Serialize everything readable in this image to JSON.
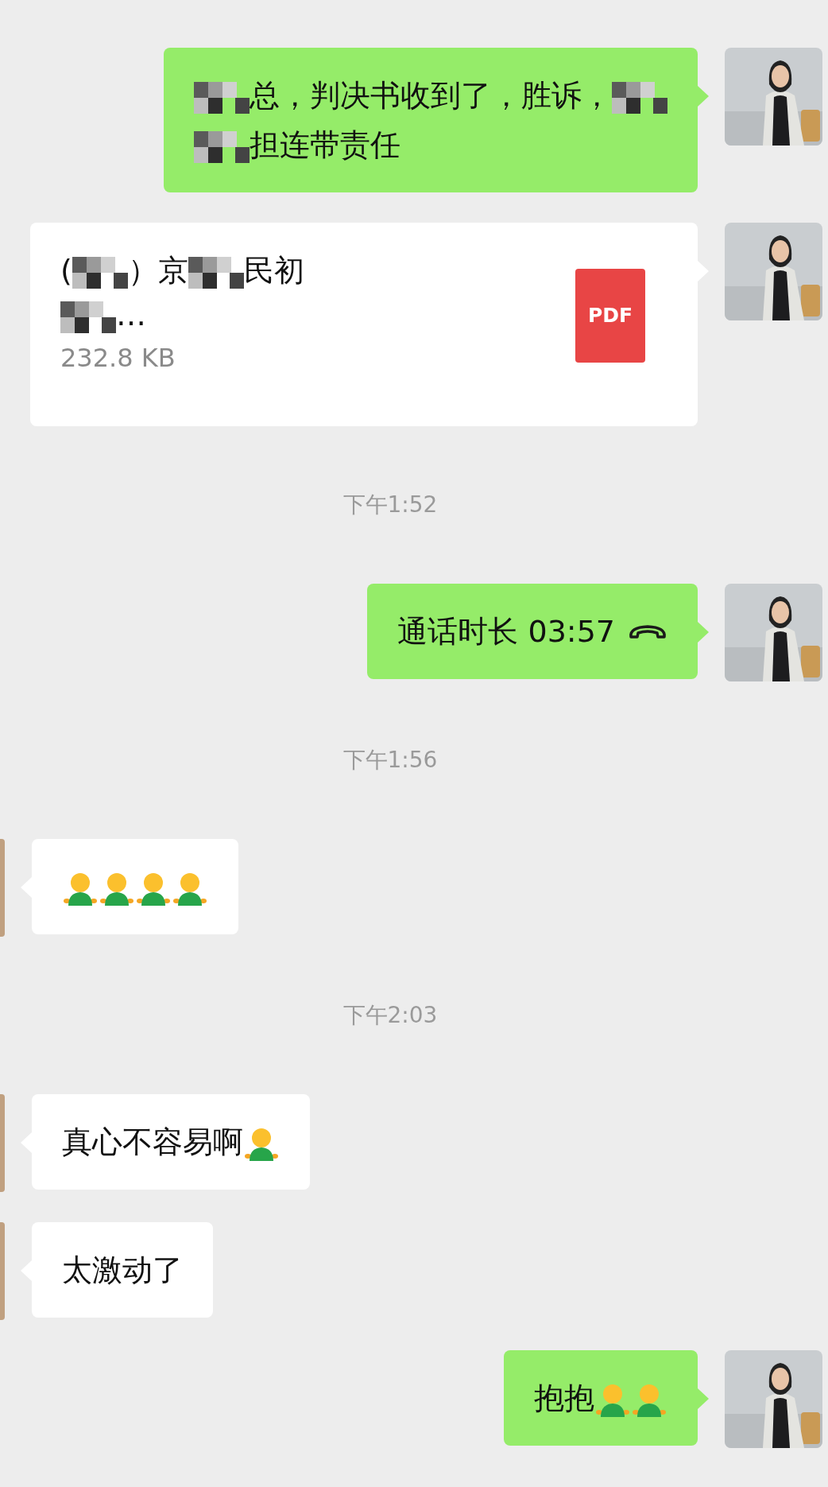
{
  "messages": [
    {
      "kind": "text",
      "outgoing": true,
      "lines": [
        [
          {
            "kind": "mosaic"
          },
          {
            "kind": "text",
            "text": "总，判决书收到了，胜诉，"
          },
          {
            "kind": "mosaic"
          }
        ],
        [
          {
            "kind": "mosaic"
          },
          {
            "kind": "text",
            "text": "担连带责任"
          }
        ]
      ]
    },
    {
      "kind": "file",
      "outgoing": true,
      "title_lines": [
        [
          {
            "kind": "text",
            "text": "("
          },
          {
            "kind": "mosaic"
          },
          {
            "kind": "text",
            "text": "）京"
          },
          {
            "kind": "mosaic"
          },
          {
            "kind": "text",
            "text": "民初"
          }
        ],
        [
          {
            "kind": "mosaic"
          },
          {
            "kind": "text",
            "text": "…"
          }
        ]
      ],
      "size": "232.8 KB",
      "file_type": "PDF"
    },
    {
      "kind": "time",
      "text": "下午1:52"
    },
    {
      "kind": "call",
      "outgoing": true,
      "text": "通话时长 03:57"
    },
    {
      "kind": "time",
      "text": "下午1:56"
    },
    {
      "kind": "text",
      "outgoing": false,
      "lines": [
        [
          {
            "kind": "emoji"
          },
          {
            "kind": "emoji"
          },
          {
            "kind": "emoji"
          },
          {
            "kind": "emoji"
          }
        ]
      ]
    },
    {
      "kind": "time",
      "text": "下午2:03"
    },
    {
      "kind": "text",
      "outgoing": false,
      "lines": [
        [
          {
            "kind": "text",
            "text": "真心不容易啊"
          },
          {
            "kind": "emoji"
          }
        ]
      ]
    },
    {
      "kind": "text",
      "outgoing": false,
      "lines": [
        [
          {
            "kind": "text",
            "text": "太激动了"
          }
        ]
      ]
    },
    {
      "kind": "text",
      "outgoing": true,
      "lines": [
        [
          {
            "kind": "text",
            "text": "抱抱"
          },
          {
            "kind": "emoji"
          },
          {
            "kind": "emoji"
          }
        ]
      ]
    }
  ]
}
